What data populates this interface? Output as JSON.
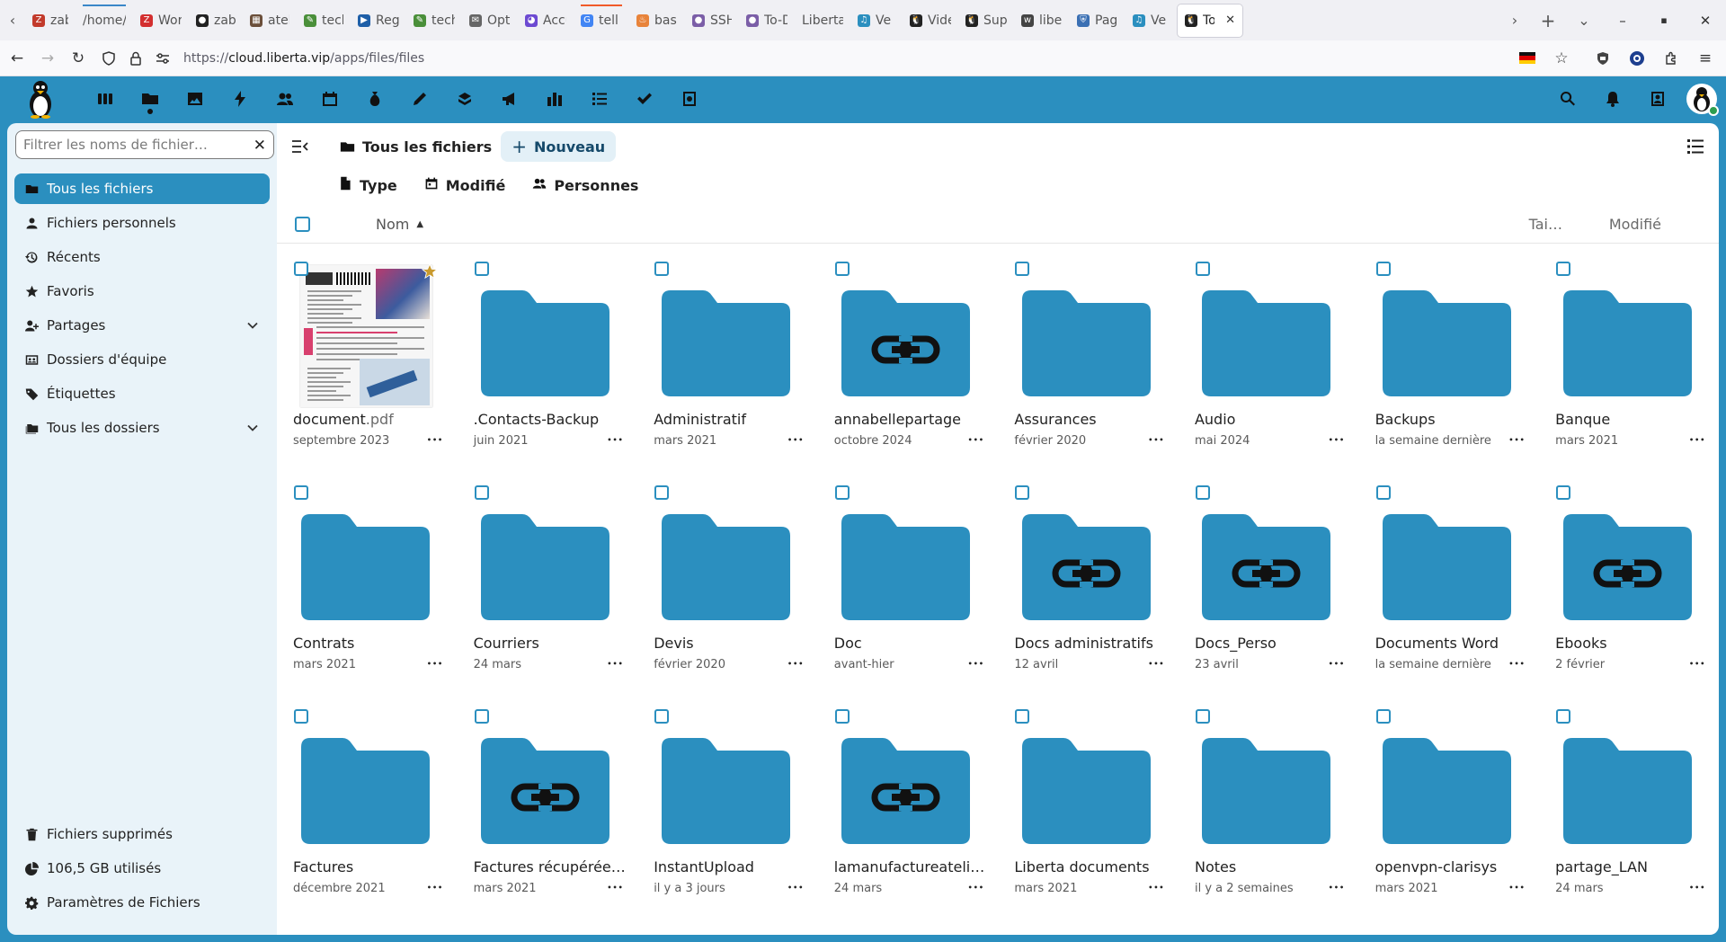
{
  "browser": {
    "tabs": [
      {
        "label": "zabb",
        "fav_color": "#c23a2b",
        "fav": "Z"
      },
      {
        "label": "/home/a",
        "fav_color": "#ffffff",
        "fav": ""
      },
      {
        "label": "Work",
        "fav_color": "#d32f2f",
        "fav": "Z"
      },
      {
        "label": "zabb",
        "fav_color": "#222222",
        "fav": "●"
      },
      {
        "label": "ateli",
        "fav_color": "#6b4f3a",
        "fav": "▦"
      },
      {
        "label": "tech",
        "fav_color": "#4a8f3a",
        "fav": "✎"
      },
      {
        "label": "Rega",
        "fav_color": "#1e5fa8",
        "fav": "▶"
      },
      {
        "label": "tech",
        "fav_color": "#4a8f3a",
        "fav": "✎"
      },
      {
        "label": "Opti",
        "fav_color": "#666666",
        "fav": "✉"
      },
      {
        "label": "Accu",
        "fav_color": "#6d4ad2",
        "fav": "◕"
      },
      {
        "label": "tell g",
        "fav_color": "#4285f4",
        "fav": "G"
      },
      {
        "label": "bash",
        "fav_color": "#e8833a",
        "fav": "♨"
      },
      {
        "label": "SSH",
        "fav_color": "#7b5ea7",
        "fav": "●"
      },
      {
        "label": "To-D",
        "fav_color": "#7b5ea7",
        "fav": "●"
      },
      {
        "label": "Liberta",
        "fav_color": "#ffffff",
        "fav": ""
      },
      {
        "label": "Ve",
        "fav_color": "#2b8fbf",
        "fav": "♫"
      },
      {
        "label": "Vide",
        "fav_color": "#222222",
        "fav": "🐧"
      },
      {
        "label": "Supe",
        "fav_color": "#222222",
        "fav": "🐧"
      },
      {
        "label": "libert",
        "fav_color": "#444444",
        "fav": "w"
      },
      {
        "label": "Page",
        "fav_color": "#3a6fb3",
        "fav": "⛨"
      },
      {
        "label": "Ve",
        "fav_color": "#2b8fbf",
        "fav": "♫"
      },
      {
        "label": "To",
        "fav_color": "#222222",
        "fav": "🐧",
        "active": true
      }
    ],
    "url_prefix": "https://",
    "url_host": "cloud.liberta.vip",
    "url_path": "/apps/files/files"
  },
  "sidebar": {
    "filter_placeholder": "Filtrer les noms de fichier…",
    "items": [
      {
        "label": "Tous les fichiers",
        "icon": "folder-icon",
        "active": true
      },
      {
        "label": "Fichiers personnels",
        "icon": "user-icon"
      },
      {
        "label": "Récents",
        "icon": "history-icon"
      },
      {
        "label": "Favoris",
        "icon": "star-icon"
      },
      {
        "label": "Partages",
        "icon": "share-icon",
        "expandable": true
      },
      {
        "label": "Dossiers d'équipe",
        "icon": "group-folder-icon"
      },
      {
        "label": "Étiquettes",
        "icon": "tag-icon"
      },
      {
        "label": "Tous les dossiers",
        "icon": "folders-icon",
        "expandable": true
      }
    ],
    "bottom": [
      {
        "label": "Fichiers supprimés",
        "icon": "trash-icon"
      },
      {
        "label": "106,5 GB utilisés",
        "icon": "pie-chart-icon"
      },
      {
        "label": "Paramètres de Fichiers",
        "icon": "settings-icon"
      }
    ]
  },
  "main": {
    "breadcrumb_home": "Tous les fichiers",
    "new_button": "Nouveau",
    "filters": [
      {
        "label": "Type",
        "icon": "file-type-icon"
      },
      {
        "label": "Modifié",
        "icon": "calendar-icon"
      },
      {
        "label": "Personnes",
        "icon": "people-icon"
      }
    ],
    "columns": {
      "name": "Nom",
      "size": "Tai…",
      "modified": "Modifié"
    },
    "files": [
      {
        "name": "document",
        "ext": ".pdf",
        "date": "septembre 2023",
        "kind": "pdf",
        "favorite": true
      },
      {
        "name": ".Contacts-Backup",
        "ext": "",
        "date": "juin 2021",
        "kind": "folder"
      },
      {
        "name": "Administratif",
        "ext": "",
        "date": "mars 2021",
        "kind": "folder"
      },
      {
        "name": "annabellepartage",
        "ext": "",
        "date": "octobre 2024",
        "kind": "shared"
      },
      {
        "name": "Assurances",
        "ext": "",
        "date": "février 2020",
        "kind": "folder"
      },
      {
        "name": "Audio",
        "ext": "",
        "date": "mai 2024",
        "kind": "folder"
      },
      {
        "name": "Backups",
        "ext": "",
        "date": "la semaine dernière",
        "kind": "folder"
      },
      {
        "name": "Banque",
        "ext": "",
        "date": "mars 2021",
        "kind": "folder"
      },
      {
        "name": "Contrats",
        "ext": "",
        "date": "mars 2021",
        "kind": "folder"
      },
      {
        "name": "Courriers",
        "ext": "",
        "date": "24 mars",
        "kind": "folder"
      },
      {
        "name": "Devis",
        "ext": "",
        "date": "février 2020",
        "kind": "folder"
      },
      {
        "name": "Doc",
        "ext": "",
        "date": "avant-hier",
        "kind": "folder"
      },
      {
        "name": "Docs administratifs",
        "ext": "",
        "date": "12 avril",
        "kind": "shared"
      },
      {
        "name": "Docs_Perso",
        "ext": "",
        "date": "23 avril",
        "kind": "shared"
      },
      {
        "name": "Documents Word",
        "ext": "",
        "date": "la semaine dernière",
        "kind": "folder"
      },
      {
        "name": "Ebooks",
        "ext": "",
        "date": "2 février",
        "kind": "shared"
      },
      {
        "name": "Factures",
        "ext": "",
        "date": "décembre 2021",
        "kind": "folder"
      },
      {
        "name": "Factures récupérée…",
        "ext": "",
        "date": "mars 2021",
        "kind": "shared"
      },
      {
        "name": "InstantUpload",
        "ext": "",
        "date": "il y a 3 jours",
        "kind": "folder"
      },
      {
        "name": "lamanufactureateli…",
        "ext": "",
        "date": "24 mars",
        "kind": "shared"
      },
      {
        "name": "Liberta documents",
        "ext": "",
        "date": "mars 2021",
        "kind": "folder"
      },
      {
        "name": "Notes",
        "ext": "",
        "date": "il y a 2 semaines",
        "kind": "folder"
      },
      {
        "name": "openvpn-clarisys",
        "ext": "",
        "date": "mars 2021",
        "kind": "folder"
      },
      {
        "name": "partage_LAN",
        "ext": "",
        "date": "24 mars",
        "kind": "folder"
      }
    ]
  },
  "colors": {
    "brand": "#2b8fbf",
    "folder": "#2b8fbf",
    "sidebar_bg": "#e9f3f9"
  }
}
